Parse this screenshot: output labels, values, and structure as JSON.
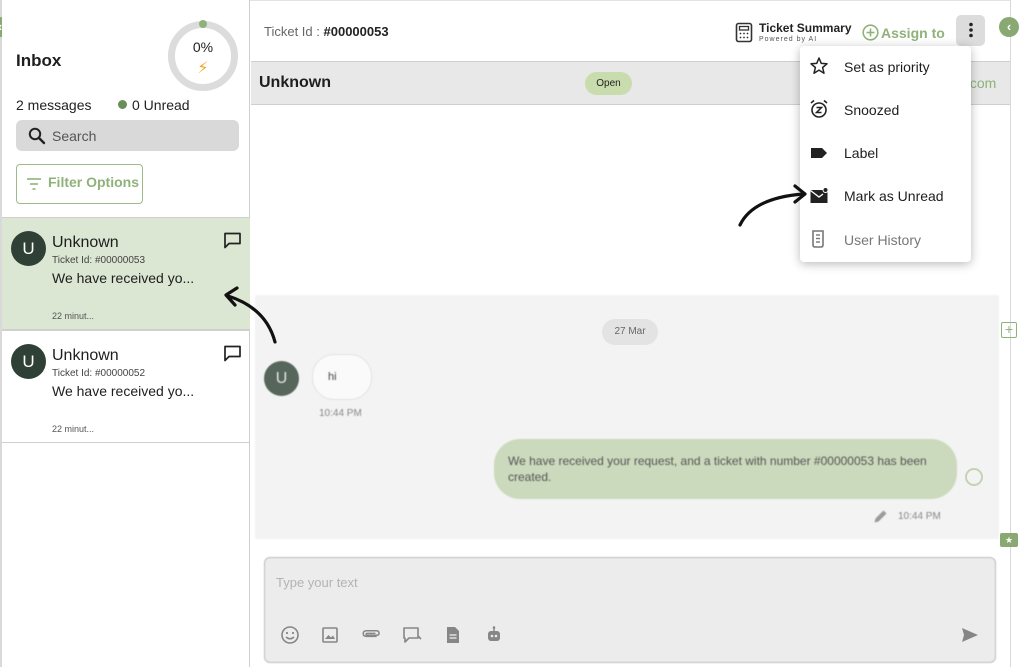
{
  "sidebar": {
    "title": "Inbox",
    "progress": {
      "label": "0%",
      "value": 0
    },
    "message_count": "2 messages",
    "unread": "0 Unread",
    "search_placeholder": "Search",
    "filter_label": "Filter Options",
    "conversations": [
      {
        "avatar": "U",
        "name": "Unknown",
        "ticket": "Ticket Id: #00000053",
        "preview": "We have received yo...",
        "time": "22 minut...",
        "active": true
      },
      {
        "avatar": "U",
        "name": "Unknown",
        "ticket": "Ticket Id: #00000052",
        "preview": "We have received yo...",
        "time": "22 minut...",
        "active": false
      }
    ]
  },
  "header": {
    "ticket_label": "Ticket Id :",
    "ticket_id": "#00000053",
    "summary_title": "Ticket Summary",
    "summary_subtitle": "Powered by AI",
    "assign_label": "Assign to",
    "more_icon": "kebab-vertical-icon"
  },
  "contact": {
    "name": "Unknown",
    "status": "Open",
    "email_fragment": ".com"
  },
  "chat": {
    "date": "27 Mar",
    "incoming": {
      "avatar": "U",
      "text": "hi",
      "time": "10:44 PM"
    },
    "outgoing": {
      "text": "We have received your request, and a ticket with number #00000053 has been created.",
      "time": "10:44 PM"
    }
  },
  "composer": {
    "placeholder": "Type your text",
    "tools": [
      "emoji-icon",
      "image-icon",
      "attachment-icon",
      "canned-response-icon",
      "document-icon",
      "bot-icon"
    ],
    "send_icon": "send-icon"
  },
  "menu": {
    "items": [
      {
        "label": "Set as priority",
        "icon": "star-icon"
      },
      {
        "label": "Snoozed",
        "icon": "snooze-clock-icon"
      },
      {
        "label": "Label",
        "icon": "label-tag-icon"
      },
      {
        "label": "Mark as Unread",
        "icon": "mark-unread-mail-icon"
      },
      {
        "label": "User History",
        "icon": "history-document-icon",
        "disabled": true
      }
    ]
  },
  "colors": {
    "accent": "#8fb27a",
    "active_row": "#dbe6d3",
    "avatar": "#2f4136",
    "outgoing_bubble": "#cbd9bc",
    "bolt": "#f3a51d"
  }
}
